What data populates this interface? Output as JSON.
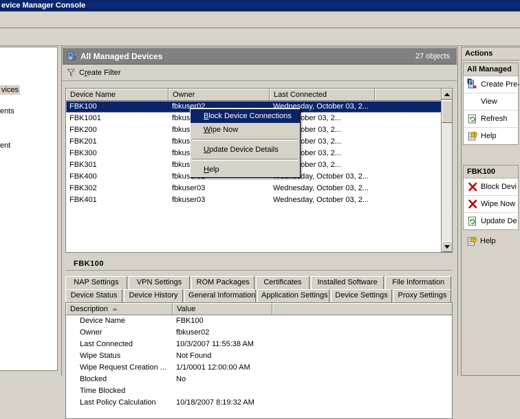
{
  "window": {
    "title": "evice Manager Console"
  },
  "tree": {
    "fragments": [
      {
        "text": "vices",
        "selected": true
      },
      {
        "text": "ents",
        "selected": false
      },
      {
        "text": "ent",
        "selected": false
      }
    ]
  },
  "center": {
    "header": {
      "icon": "device-list-icon",
      "title": "All Managed Devices",
      "count": "27 objects"
    },
    "filter": {
      "icon": "filter-icon",
      "label_pre": "C",
      "label_accel": "r",
      "label_post": "eate Filter",
      "label": "Create Filter"
    },
    "grid": {
      "columns": [
        "Device Name",
        "Owner",
        "Last Connected",
        ""
      ],
      "rows": [
        {
          "name": "FBK100",
          "owner": "fbkuser02",
          "last": "Wednesday, October 03, 2...",
          "selected": true
        },
        {
          "name": "FBK1001",
          "owner": "fbkus",
          "last": "day, October 03, 2...",
          "selected": false
        },
        {
          "name": "FBK200",
          "owner": "fbkus",
          "last": "day, October 03, 2...",
          "selected": false
        },
        {
          "name": "FBK201",
          "owner": "fbkus",
          "last": "day, October 03, 2...",
          "selected": false
        },
        {
          "name": "FBK300",
          "owner": "fbkus",
          "last": "day, October 03, 2...",
          "selected": false
        },
        {
          "name": "FBK301",
          "owner": "fbkus",
          "last": "day, October 03, 2...",
          "selected": false
        },
        {
          "name": "FBK400",
          "owner": "fbkuser02",
          "last": "Wednesday, October 03, 2...",
          "selected": false
        },
        {
          "name": "FBK302",
          "owner": "fbkuser03",
          "last": "Wednesday, October 03, 2...",
          "selected": false
        },
        {
          "name": "FBK401",
          "owner": "fbkuser03",
          "last": "Wednesday, October 03, 2...",
          "selected": false
        }
      ]
    }
  },
  "context_menu": {
    "items": [
      {
        "label": "Block Device Connections",
        "accel": "B",
        "highlighted": true
      },
      {
        "label": "Wipe Now",
        "accel": "W",
        "highlighted": false
      },
      {
        "separator": true
      },
      {
        "label": "Update Device Details",
        "accel": "U",
        "highlighted": false
      },
      {
        "separator": true
      },
      {
        "label": "Help",
        "accel": "H",
        "highlighted": false
      }
    ]
  },
  "detail": {
    "title": "FBK100",
    "tabs_row1": [
      "NAP Settings",
      "VPN Settings",
      "ROM Packages",
      "Certificates",
      "Installed Software",
      "File Information"
    ],
    "tabs_row2": [
      "Device Status",
      "Device History",
      "General Information",
      "Application Settings",
      "Device Settings",
      "Proxy Settings"
    ],
    "active_tab": "Device Status",
    "columns": [
      "Description",
      "Value",
      ""
    ],
    "sort": {
      "column": "Description",
      "direction": "asc"
    },
    "rows": [
      {
        "k": "Device Name",
        "v": "FBK100"
      },
      {
        "k": "Owner",
        "v": "fbkuser02"
      },
      {
        "k": "Last Connected",
        "v": "10/3/2007 11:55:38 AM"
      },
      {
        "k": "Wipe Status",
        "v": "Not Found"
      },
      {
        "k": "Wipe Request Creation ...",
        "v": "1/1/0001 12:00:00 AM"
      },
      {
        "k": "Blocked",
        "v": "No"
      },
      {
        "k": "Time Blocked",
        "v": ""
      },
      {
        "k": "Last Policy Calculation",
        "v": "10/18/2007 8:19:32 AM"
      }
    ]
  },
  "actions": {
    "title": "Actions",
    "group1": {
      "header": "All Managed D",
      "items": [
        {
          "label": "Create Pre-",
          "icon": "create-predefined-icon"
        },
        {
          "label": "View",
          "icon": ""
        },
        {
          "label": "Refresh",
          "icon": "refresh-icon"
        },
        {
          "label": "Help",
          "icon": "help-icon"
        }
      ]
    },
    "group2": {
      "header": "FBK100",
      "items": [
        {
          "label": "Block Devi",
          "icon": "block-x-icon"
        },
        {
          "label": "Wipe Now",
          "icon": "wipe-x-icon"
        },
        {
          "label": "Update De",
          "icon": "update-icon"
        }
      ]
    },
    "group3": {
      "items": [
        {
          "label": "Help",
          "icon": "help-icon"
        }
      ]
    }
  },
  "colors": {
    "titlebar": "#0a246a",
    "selection": "#0a246a",
    "panel_header": "#808080",
    "face": "#d6d2c8",
    "danger": "#c00000"
  }
}
